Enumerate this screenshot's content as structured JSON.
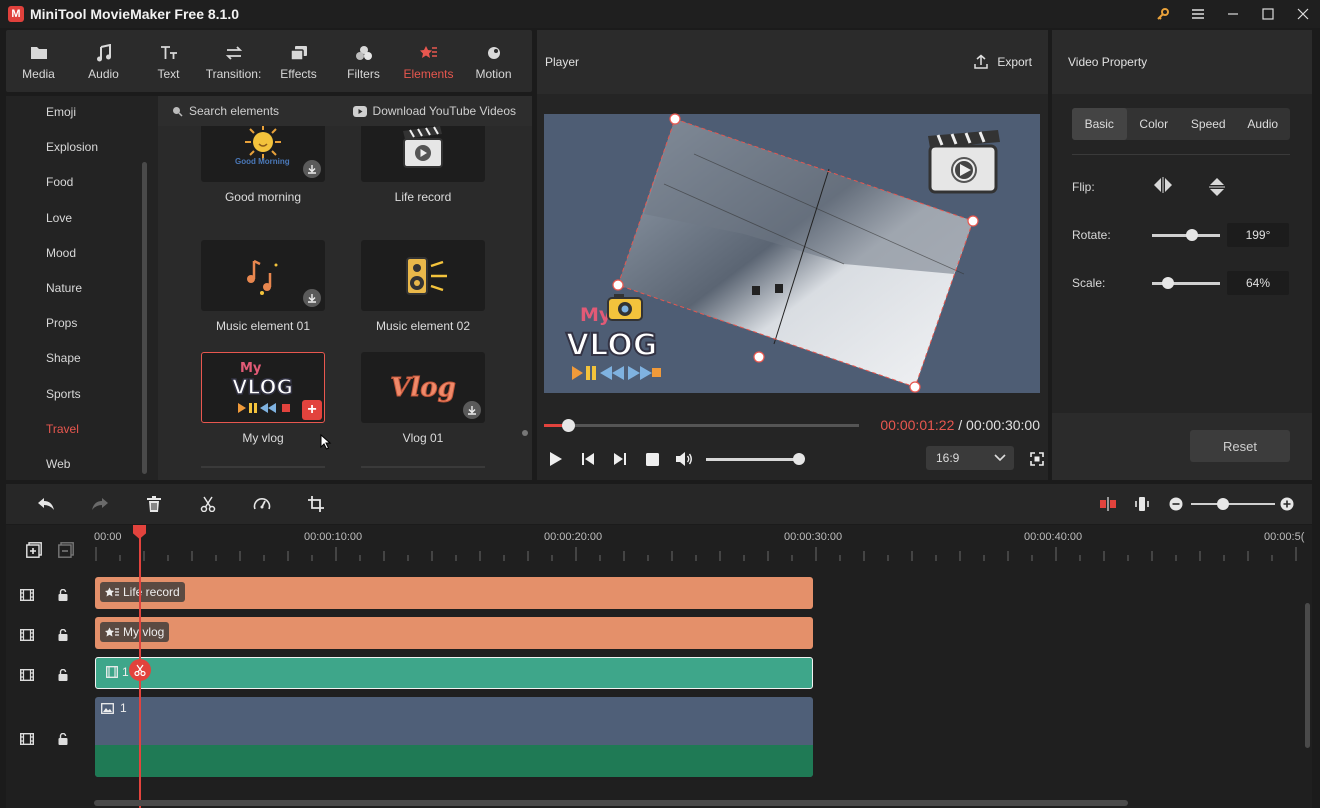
{
  "app": {
    "title": "MiniTool MovieMaker Free 8.1.0",
    "logo": "M"
  },
  "window_controls": [
    "key-icon",
    "menu-icon",
    "minimize-icon",
    "maximize-icon",
    "close-icon"
  ],
  "toolbar": {
    "items": [
      {
        "label": "Media",
        "icon": "folder-icon"
      },
      {
        "label": "Audio",
        "icon": "music-note-icon"
      },
      {
        "label": "Text",
        "icon": "text-icon"
      },
      {
        "label": "Transition:",
        "icon": "transition-icon"
      },
      {
        "label": "Effects",
        "icon": "effects-icon"
      },
      {
        "label": "Filters",
        "icon": "filters-icon"
      },
      {
        "label": "Elements",
        "icon": "elements-icon",
        "active": true
      },
      {
        "label": "Motion",
        "icon": "motion-icon"
      }
    ]
  },
  "categories": {
    "items": [
      "Emoji",
      "Explosion",
      "Food",
      "Love",
      "Mood",
      "Nature",
      "Props",
      "Shape",
      "Sports",
      "Travel",
      "Web"
    ],
    "active": "Travel"
  },
  "elements": {
    "search_placeholder": "Search elements",
    "download_label": "Download YouTube Videos",
    "cards": [
      {
        "label": "Good morning",
        "thumb_text": "Good Morning",
        "badge": "download"
      },
      {
        "label": "Life record",
        "badge": "none"
      },
      {
        "label": "Music element 01",
        "badge": "download"
      },
      {
        "label": "Music element 02",
        "badge": "none"
      },
      {
        "label": "My vlog",
        "thumb_text": "My VLOG",
        "badge": "add"
      },
      {
        "label": "Vlog 01",
        "thumb_text": "Vlog",
        "badge": "download"
      }
    ]
  },
  "player": {
    "title": "Player",
    "export_label": "Export",
    "overlay_text_top": "My",
    "overlay_text_main": "VLOG",
    "progress": 0.08,
    "current_time": "00:00:01:22",
    "separator": " / ",
    "total_time": "00:00:30:00",
    "volume": 0.9,
    "aspect_ratio": "16:9"
  },
  "properties": {
    "title": "Video Property",
    "tabs": [
      "Basic",
      "Color",
      "Speed",
      "Audio"
    ],
    "active_tab": "Basic",
    "flip_label": "Flip:",
    "rotate_label": "Rotate:",
    "rotate_value": "199°",
    "scale_label": "Scale:",
    "scale_value": "64%",
    "reset_label": "Reset"
  },
  "timeline": {
    "ruler_labels": [
      "00:00",
      "00:00:10:00",
      "00:00:20:00",
      "00:00:30:00",
      "00:00:40:00",
      "00:00:5("
    ],
    "tracks": [
      {
        "label": "Life record",
        "color": "#e4906a"
      },
      {
        "label": "My vlog",
        "color": "#e4906a"
      },
      {
        "label": "1",
        "color": "#3ea68a"
      },
      {
        "label": "1",
        "color": "#4f5f78"
      }
    ],
    "playhead_time_seconds": 1.7
  },
  "colors": {
    "accent": "#e8574f",
    "clip_orange": "#e4906a",
    "clip_teal": "#3ea68a",
    "stage_bg": "#4e5d74"
  }
}
